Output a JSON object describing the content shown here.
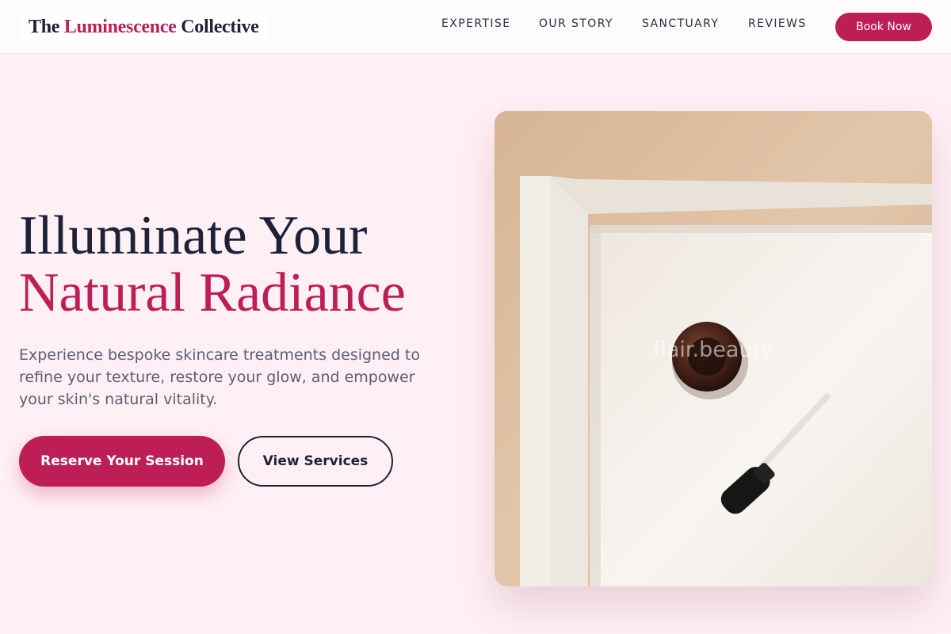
{
  "header": {
    "logo": {
      "prefix": "The",
      "accent": "Luminescence",
      "suffix": "Collective"
    },
    "nav": [
      {
        "label": "EXPERTISE"
      },
      {
        "label": "OUR STORY"
      },
      {
        "label": "SANCTUARY"
      },
      {
        "label": "REVIEWS"
      }
    ],
    "cta_label": "Book Now"
  },
  "hero": {
    "headline_line1": "Illuminate Your",
    "headline_line2": "Natural Radiance",
    "description": "Experience bespoke skincare treatments designed to refine your texture, restore your glow, and empower your skin's natural vitality.",
    "primary_button": "Reserve Your Session",
    "secondary_button": "View Services",
    "image": {
      "subject": "serum-dropper-bottle-on-white-towel",
      "watermark": "flair.beauty"
    }
  },
  "colors": {
    "accent": "#be1e56",
    "dark": "#1e2238",
    "background": "#fff0f5",
    "body_text": "#5c5f72"
  }
}
